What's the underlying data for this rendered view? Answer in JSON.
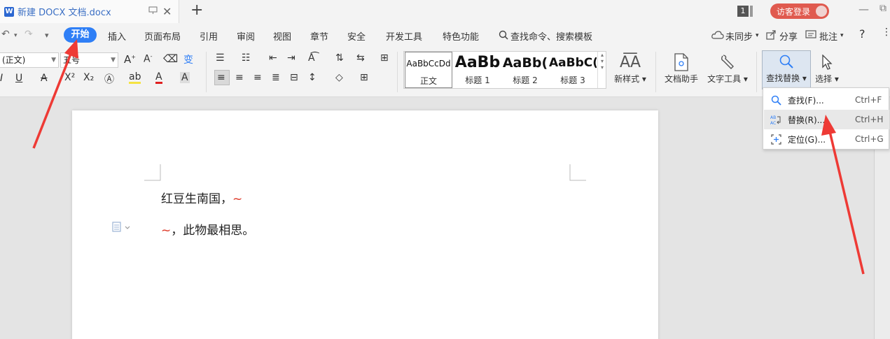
{
  "titlebar": {
    "tab_title": "新建 DOCX 文档.docx",
    "tab_icon_letter": "W",
    "close_glyph": "✕",
    "add_glyph": "+",
    "badge_number": "1",
    "login_label": "访客登录",
    "minimize_glyph": "—",
    "restore_glyph": "⧉"
  },
  "menubar": {
    "undo_glyph": "↶",
    "redo_glyph": "↷",
    "more_glyph": "▾",
    "active": "开始",
    "items": [
      "插入",
      "页面布局",
      "引用",
      "审阅",
      "视图",
      "章节",
      "安全",
      "开发工具",
      "特色功能"
    ],
    "search_label": "查找命令、搜索模板",
    "sync_label": "未同步",
    "share_label": "分享",
    "comment_label": "批注",
    "help_glyph": "?"
  },
  "ribbon": {
    "font_name": "(正文)",
    "font_size": "五号",
    "styles": [
      {
        "sample": "AaBbCcDd",
        "label": "正文"
      },
      {
        "sample": "AaBb",
        "label": "标题 1"
      },
      {
        "sample": "AaBb(",
        "label": "标题 2"
      },
      {
        "sample": "AaBbC(",
        "label": "标题 3"
      }
    ],
    "new_style_label": "新样式",
    "doc_helper_label": "文档助手",
    "text_tools_label": "文字工具",
    "find_replace_label": "查找替换",
    "select_label": "选择"
  },
  "document": {
    "line1_text": "红豆生南国，",
    "line1_mark": "~",
    "line2_mark": "~",
    "line2_text": "，此物最相思。"
  },
  "dropdown": {
    "items": [
      {
        "label": "查找(F)...",
        "shortcut": "Ctrl+F",
        "icon": "search-icon"
      },
      {
        "label": "替换(R)...",
        "shortcut": "Ctrl+H",
        "icon": "replace-icon"
      },
      {
        "label": "定位(G)...",
        "shortcut": "Ctrl+G",
        "icon": "locate-icon"
      }
    ]
  },
  "colors": {
    "accent": "#2f7ff6",
    "login": "#e05a4f",
    "annotation_arrow": "#ee3a35"
  }
}
